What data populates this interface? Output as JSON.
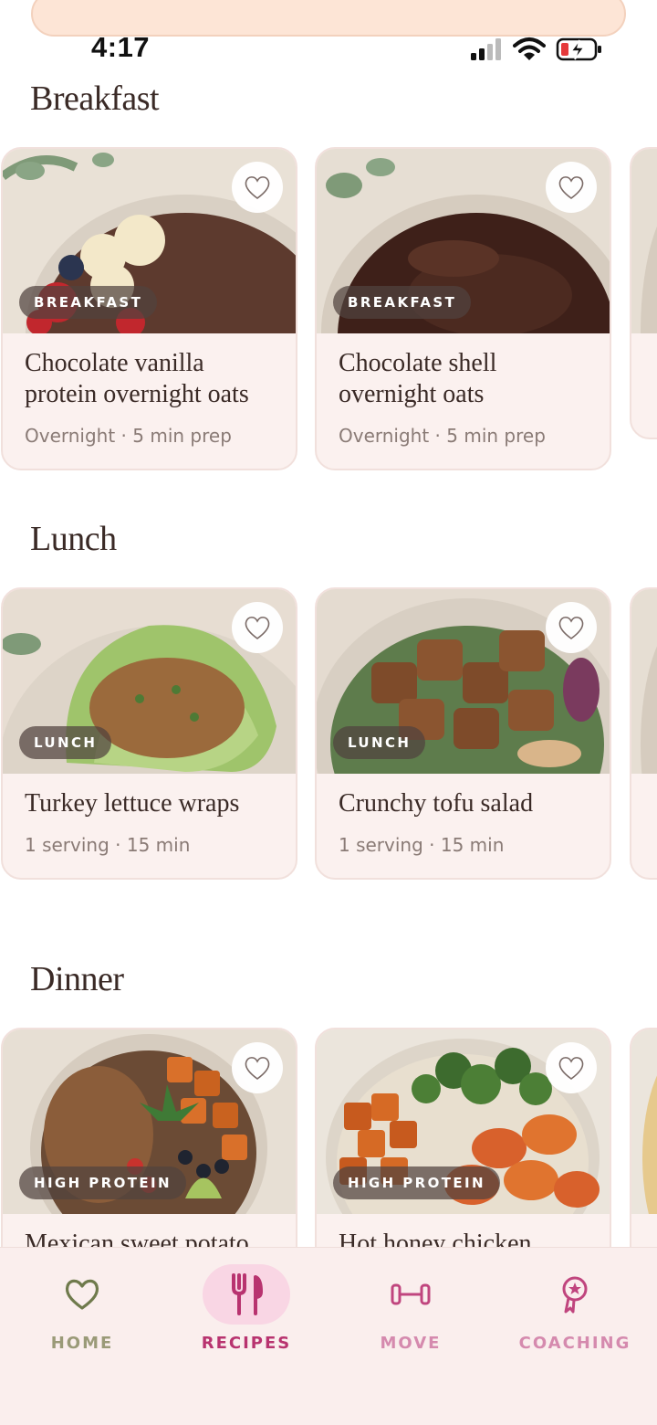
{
  "status_bar": {
    "time": "4:17"
  },
  "sections": [
    {
      "title": "Breakfast",
      "cards": [
        {
          "title": "Chocolate vanilla protein overnight oats",
          "meta": "Overnight · 5 min prep",
          "tag": "BREAKFAST",
          "image": "chocolate-oats-banana-berries"
        },
        {
          "title": "Chocolate shell overnight oats",
          "meta": "Overnight · 5 min prep",
          "tag": "BREAKFAST",
          "image": "chocolate-shell-oats"
        }
      ]
    },
    {
      "title": "Lunch",
      "cards": [
        {
          "title": "Turkey lettuce wraps",
          "meta": "1 serving · 15 min",
          "tag": "LUNCH",
          "image": "turkey-lettuce-wraps"
        },
        {
          "title": "Crunchy tofu salad",
          "meta": "1 serving · 15 min",
          "tag": "LUNCH",
          "image": "crunchy-tofu-salad"
        }
      ]
    },
    {
      "title": "Dinner",
      "cards": [
        {
          "title": "Mexican sweet potato",
          "meta": "",
          "tag": "HIGH PROTEIN",
          "image": "mexican-sweet-potato-bowl"
        },
        {
          "title": "Hot honey chicken nugget",
          "meta": "",
          "tag": "HIGH PROTEIN",
          "image": "hot-honey-chicken-bowl"
        }
      ]
    }
  ],
  "nav": {
    "items": [
      {
        "label": "HOME",
        "icon": "heart-icon",
        "active": false
      },
      {
        "label": "RECIPES",
        "icon": "fork-knife-icon",
        "active": true
      },
      {
        "label": "MOVE",
        "icon": "dumbbell-icon",
        "active": false
      },
      {
        "label": "COACHING",
        "icon": "award-icon",
        "active": false
      }
    ]
  },
  "colors": {
    "accent_pink": "#c0457e",
    "home_green": "#6f7a4c",
    "card_bg": "#fbf1ef",
    "nav_bg": "#faeeed",
    "active_pill": "#f9d6e4"
  }
}
